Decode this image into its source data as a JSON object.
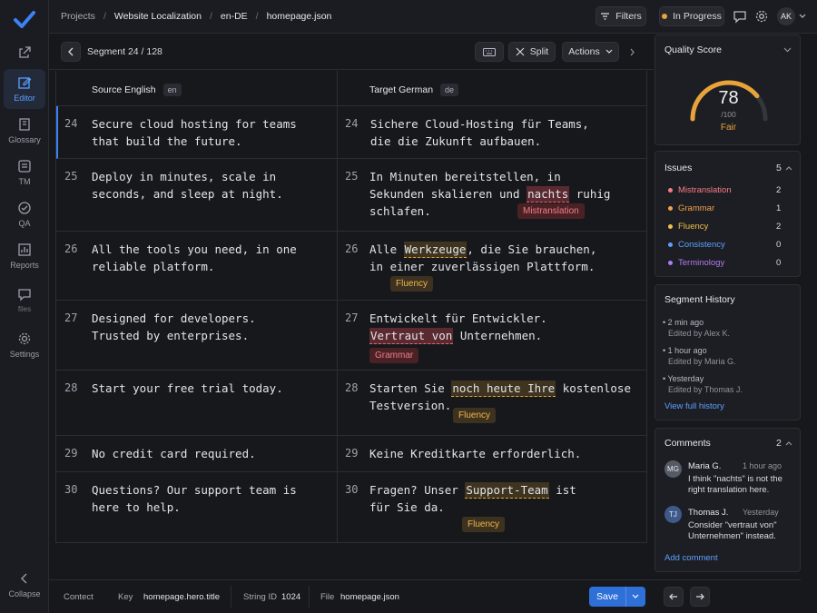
{
  "rail": {
    "items": [
      {
        "label": "",
        "icon": "share-icon"
      },
      {
        "label": "Editor",
        "icon": "edit-icon"
      },
      {
        "label": "Glossary",
        "icon": "book-icon"
      },
      {
        "label": "TM",
        "icon": "memory-icon"
      },
      {
        "label": "QA",
        "icon": "check-circle-icon"
      },
      {
        "label": "Reports",
        "icon": "chart-icon"
      },
      {
        "label": "files",
        "icon": "comment-icon"
      },
      {
        "label": "Settings",
        "icon": "gear-icon"
      }
    ],
    "collapse_label": "Collapse"
  },
  "breadcrumb": [
    "Projects",
    "Website Localization",
    "en-DE",
    "homepage.json"
  ],
  "topbar": {
    "filters_label": "Filters",
    "status_label": "In Progress",
    "avatar_initials": "AK"
  },
  "toolbar": {
    "segment_label": "Segment 24 / 128",
    "split_label": "Split",
    "actions_label": "Actions"
  },
  "columns": {
    "source_title": "Source English",
    "source_lang": "en",
    "target_title": "Target German",
    "target_lang": "de"
  },
  "rows": [
    {
      "n": "24",
      "src": "Secure cloud hosting for teams\nthat build the future.",
      "tgt": "Sichere Cloud-Hosting für Teams,\ndie die Zukunft aufbauen."
    },
    {
      "n": "25",
      "src": "Deploy in minutes, scale in\nseconds, and sleep at night.",
      "tgt_pre": "In Minuten bereitstellen, in\nSekunden skalieren und ",
      "tgt_hl": "nachts",
      "tgt_post": " ruhig\nschlafen.",
      "tag": "Mistranslation"
    },
    {
      "n": "26",
      "src": "All the tools you need, in one\nreliable platform.",
      "tgt_pre": "Alle ",
      "tgt_hl": "Werkzeuge",
      "tgt_post": ", die Sie brauchen,\nin einer zuverlässigen Plattform.",
      "tag": "Fluency"
    },
    {
      "n": "27",
      "src": "Designed for developers.\nTrusted by enterprises.",
      "tgt_pre": "Entwickelt für Entwickler.\n",
      "tgt_hl": "Vertraut von",
      "tgt_post": " Unternehmen.",
      "tag": "Grammar"
    },
    {
      "n": "28",
      "src": "Start your free trial today.",
      "tgt_pre": "Starten Sie ",
      "tgt_hl": "noch heute Ihre",
      "tgt_post": " kostenlose\nTestversion.",
      "tag": "Fluency"
    },
    {
      "n": "29",
      "src": "No credit card required.",
      "tgt": "Keine Kreditkarte erforderlich."
    },
    {
      "n": "30",
      "src": "Questions? Our support team is\nhere to help.",
      "tgt_pre": "Fragen? Unser ",
      "tgt_hl": "Support-Team",
      "tgt_post": " ist\nfür Sie da.",
      "tag": "Fluency"
    }
  ],
  "quality": {
    "title": "Quality Score",
    "score": "78",
    "max": "/100",
    "rating": "Fair",
    "fraction": 0.78
  },
  "issues": {
    "title": "Issues",
    "total": "5",
    "items": [
      {
        "label": "Mistranslation",
        "count": "2",
        "color": "#f27d86"
      },
      {
        "label": "Grammar",
        "count": "1",
        "color": "#f0a24a"
      },
      {
        "label": "Fluency",
        "count": "2",
        "color": "#f0c04a"
      },
      {
        "label": "Consistency",
        "count": "0",
        "color": "#5aa0ff"
      },
      {
        "label": "Terminology",
        "count": "0",
        "color": "#b07cf0"
      }
    ]
  },
  "history": {
    "title": "Segment History",
    "items": [
      {
        "time": "2 min ago",
        "who": "Edited by Alex K."
      },
      {
        "time": "1 hour ago",
        "who": "Edited by Maria G."
      },
      {
        "time": "Yesterday",
        "who": "Edited by Thomas J."
      }
    ],
    "link": "View full history"
  },
  "comments": {
    "title": "Comments",
    "count": "2",
    "items": [
      {
        "initials": "MG",
        "name": "Maria G.",
        "time": "1 hour ago",
        "text": "I think \"nachts\" is not the\nright translation here."
      },
      {
        "initials": "TJ",
        "name": "Thomas J.",
        "time": "Yesterday",
        "text": "Consider \"vertraut von\"\nUnternehmen\" instead."
      }
    ],
    "add_label": "Add comment"
  },
  "bottombar": {
    "context_label": "Contect",
    "key_label": "Key",
    "key_value": "homepage.hero.title",
    "string_label": "String ID",
    "string_value": "1024",
    "file_label": "File",
    "file_value": "homepage.json",
    "save_label": "Save"
  }
}
